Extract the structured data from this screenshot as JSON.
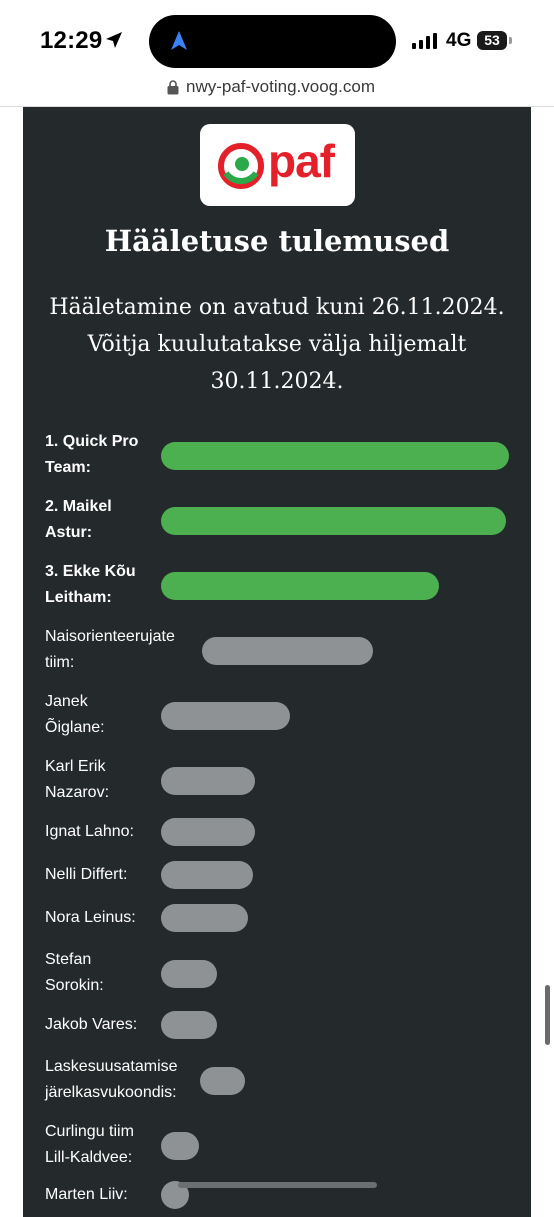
{
  "status_bar": {
    "time": "12:29",
    "network": "4G",
    "battery": "53"
  },
  "browser": {
    "url": "nwy-paf-voting.voog.com"
  },
  "page": {
    "logo_text": "paf",
    "title": "Hääletuse tulemused",
    "subtitle_line1": "Hääletamine on avatud kuni 26.11.2024.",
    "subtitle_line2": "Võitja kuulutatakse välja hiljemalt",
    "subtitle_line3": "30.11.2024."
  },
  "colors": {
    "card_bg": "#24292b",
    "winner_bar": "#4caf50",
    "other_bar": "#8e9294",
    "brand_red": "#e4202a",
    "brand_green": "#2aa84a"
  },
  "results": [
    {
      "line1": "1. Quick Pro",
      "line2": "Team:",
      "top": true,
      "share": 1.0
    },
    {
      "line1": "2. Maikel",
      "line2": "Astur:",
      "top": true,
      "share": 0.99
    },
    {
      "line1": "3. Ekke Kõu",
      "line2": "Leitham:",
      "top": true,
      "share": 0.8
    },
    {
      "line1": "Naisorienteerujate",
      "line2": "tiim:",
      "top": false,
      "share": 0.49
    },
    {
      "line1": "Janek",
      "line2": "Õiglane:",
      "top": false,
      "share": 0.37
    },
    {
      "line1": "Karl Erik",
      "line2": "Nazarov:",
      "top": false,
      "share": 0.27
    },
    {
      "line1": "Ignat Lahno:",
      "line2": "",
      "top": false,
      "share": 0.27
    },
    {
      "line1": "Nelli Differt:",
      "line2": "",
      "top": false,
      "share": 0.265
    },
    {
      "line1": "Nora Leinus:",
      "line2": "",
      "top": false,
      "share": 0.25
    },
    {
      "line1": "Stefan",
      "line2": "Sorokin:",
      "top": false,
      "share": 0.16
    },
    {
      "line1": "Jakob Vares:",
      "line2": "",
      "top": false,
      "share": 0.16
    },
    {
      "line1": "Laskesuusatamise",
      "line2": "järelkasvukoondis:",
      "top": false,
      "share": 0.13
    },
    {
      "line1": "Curlingu tiim",
      "line2": "Lill-Kaldvee:",
      "top": false,
      "share": 0.11
    },
    {
      "line1": "Marten Liiv:",
      "line2": "",
      "top": false,
      "share": 0.06
    }
  ]
}
